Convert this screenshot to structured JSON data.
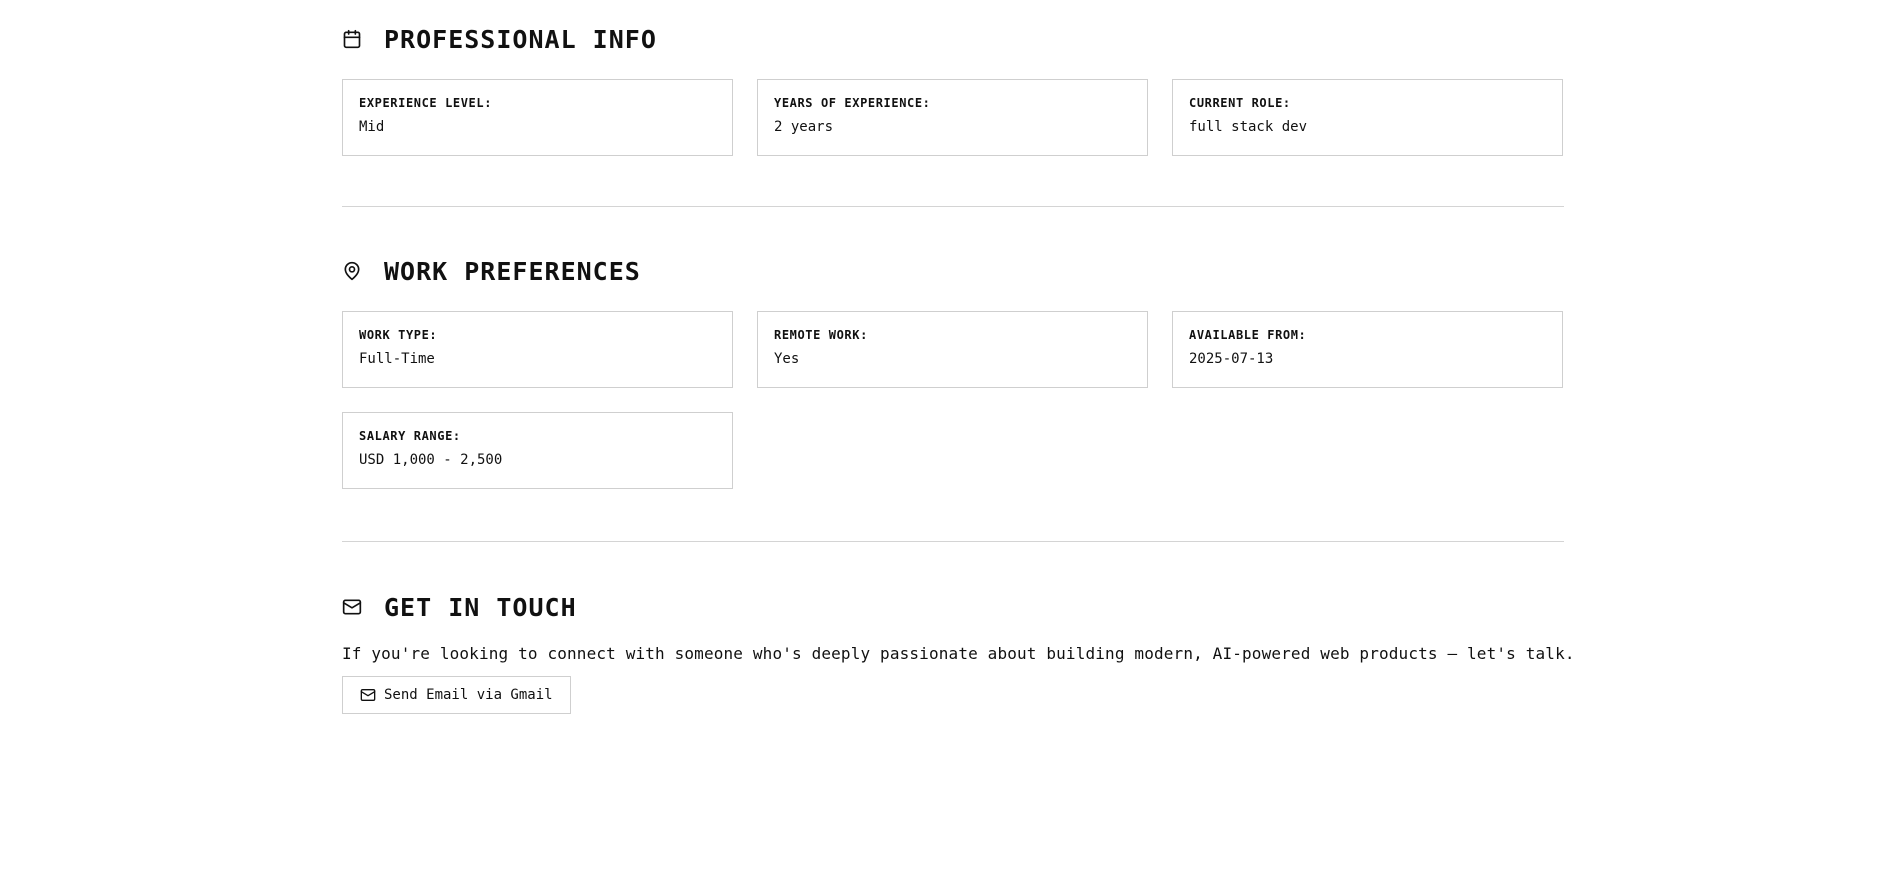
{
  "professional": {
    "title": "PROFESSIONAL INFO",
    "icon": "calendar-icon",
    "fields": [
      {
        "label": "EXPERIENCE LEVEL:",
        "value": "Mid"
      },
      {
        "label": "YEARS OF EXPERIENCE:",
        "value": "2 years"
      },
      {
        "label": "CURRENT ROLE:",
        "value": "full stack dev"
      }
    ]
  },
  "preferences": {
    "title": "WORK PREFERENCES",
    "icon": "location-pin-icon",
    "fields": [
      {
        "label": "WORK TYPE:",
        "value": "Full-Time"
      },
      {
        "label": "REMOTE WORK:",
        "value": "Yes"
      },
      {
        "label": "AVAILABLE FROM:",
        "value": "2025-07-13"
      },
      {
        "label": "SALARY RANGE:",
        "value": "USD 1,000 - 2,500"
      }
    ]
  },
  "contact": {
    "title": "GET IN TOUCH",
    "icon": "mail-icon",
    "text": "If you're looking to connect with someone who's deeply passionate about building modern, AI-powered web products — let's talk.",
    "button_label": "Send Email via Gmail",
    "button_icon": "mail-icon"
  }
}
